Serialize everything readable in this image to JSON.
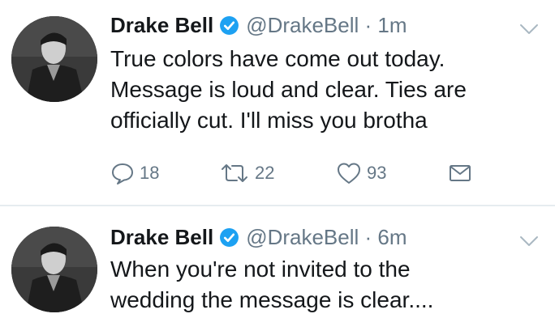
{
  "tweets": [
    {
      "display_name": "Drake Bell",
      "handle_time": "@DrakeBell · 1m",
      "body_lines": [
        "True colors have come out today.",
        "Message is loud and clear. Ties are",
        "officially cut. I'll miss you brotha"
      ],
      "reply_count": "18",
      "retweet_count": "22",
      "like_count": "93"
    },
    {
      "display_name": "Drake Bell",
      "handle_time": "@DrakeBell · 6m",
      "body_lines": [
        "When you're not invited to the",
        "wedding the message is clear...."
      ]
    }
  ],
  "colors": {
    "text": "#14171a",
    "secondary": "#657786",
    "verified": "#1da1f2",
    "divider": "#e6ecf0"
  },
  "icons": [
    "verified-badge-icon",
    "chevron-down-icon",
    "reply-icon",
    "retweet-icon",
    "like-icon",
    "direct-message-icon"
  ]
}
